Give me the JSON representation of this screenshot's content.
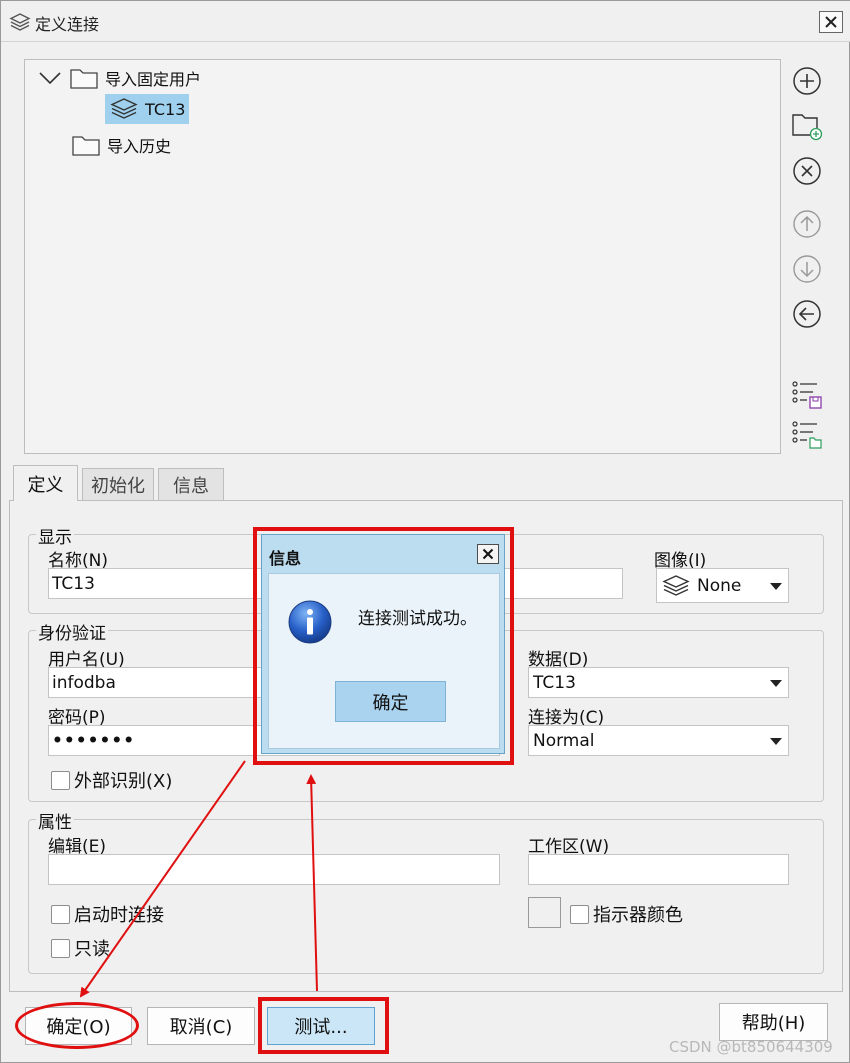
{
  "window": {
    "title": "定义连接",
    "icon": "layers-icon"
  },
  "tree": {
    "items": [
      {
        "label": "导入固定用户",
        "icon": "folder-icon",
        "expanded": true
      },
      {
        "label": "TC13",
        "icon": "layers-icon",
        "selected": true
      },
      {
        "label": "导入历史",
        "icon": "folder-icon"
      }
    ]
  },
  "side_toolbar": [
    "add-circle-icon",
    "new-folder-icon",
    "delete-circle-icon",
    "move-up-icon",
    "move-down-icon",
    "back-arrow-icon",
    "save-list-icon",
    "open-list-icon"
  ],
  "tabs": [
    {
      "label": "定义",
      "active": true
    },
    {
      "label": "初始化"
    },
    {
      "label": "信息"
    }
  ],
  "display_group": {
    "title": "显示",
    "name_label": "名称(N)",
    "name_value": "TC13",
    "image_label": "图像(I)",
    "image_value": "None"
  },
  "auth_group": {
    "title": "身份验证",
    "username_label": "用户名(U)",
    "username_value": "infodba",
    "password_label": "密码(P)",
    "password_value": "•••••••",
    "external_label": "外部识别(X)",
    "data_label": "数据(D)",
    "data_value": "TC13",
    "connect_as_label": "连接为(C)",
    "connect_as_value": "Normal"
  },
  "props_group": {
    "title": "属性",
    "editor_label": "编辑(E)",
    "editor_value": "",
    "workspace_label": "工作区(W)",
    "workspace_value": "",
    "autoconnect_label": "启动时连接",
    "readonly_label": "只读",
    "indicator_color_label": "指示器颜色"
  },
  "buttons": {
    "ok": "确定(O)",
    "cancel": "取消(C)",
    "test": "测试...",
    "help": "帮助(H)"
  },
  "dialog": {
    "title": "信息",
    "message": "连接测试成功。",
    "ok": "确定"
  },
  "colors": {
    "annotation": "#e01010",
    "selection": "#9fd1ee",
    "dialog_frame": "#bcdcef"
  },
  "watermark": "CSDN @bt850644309"
}
